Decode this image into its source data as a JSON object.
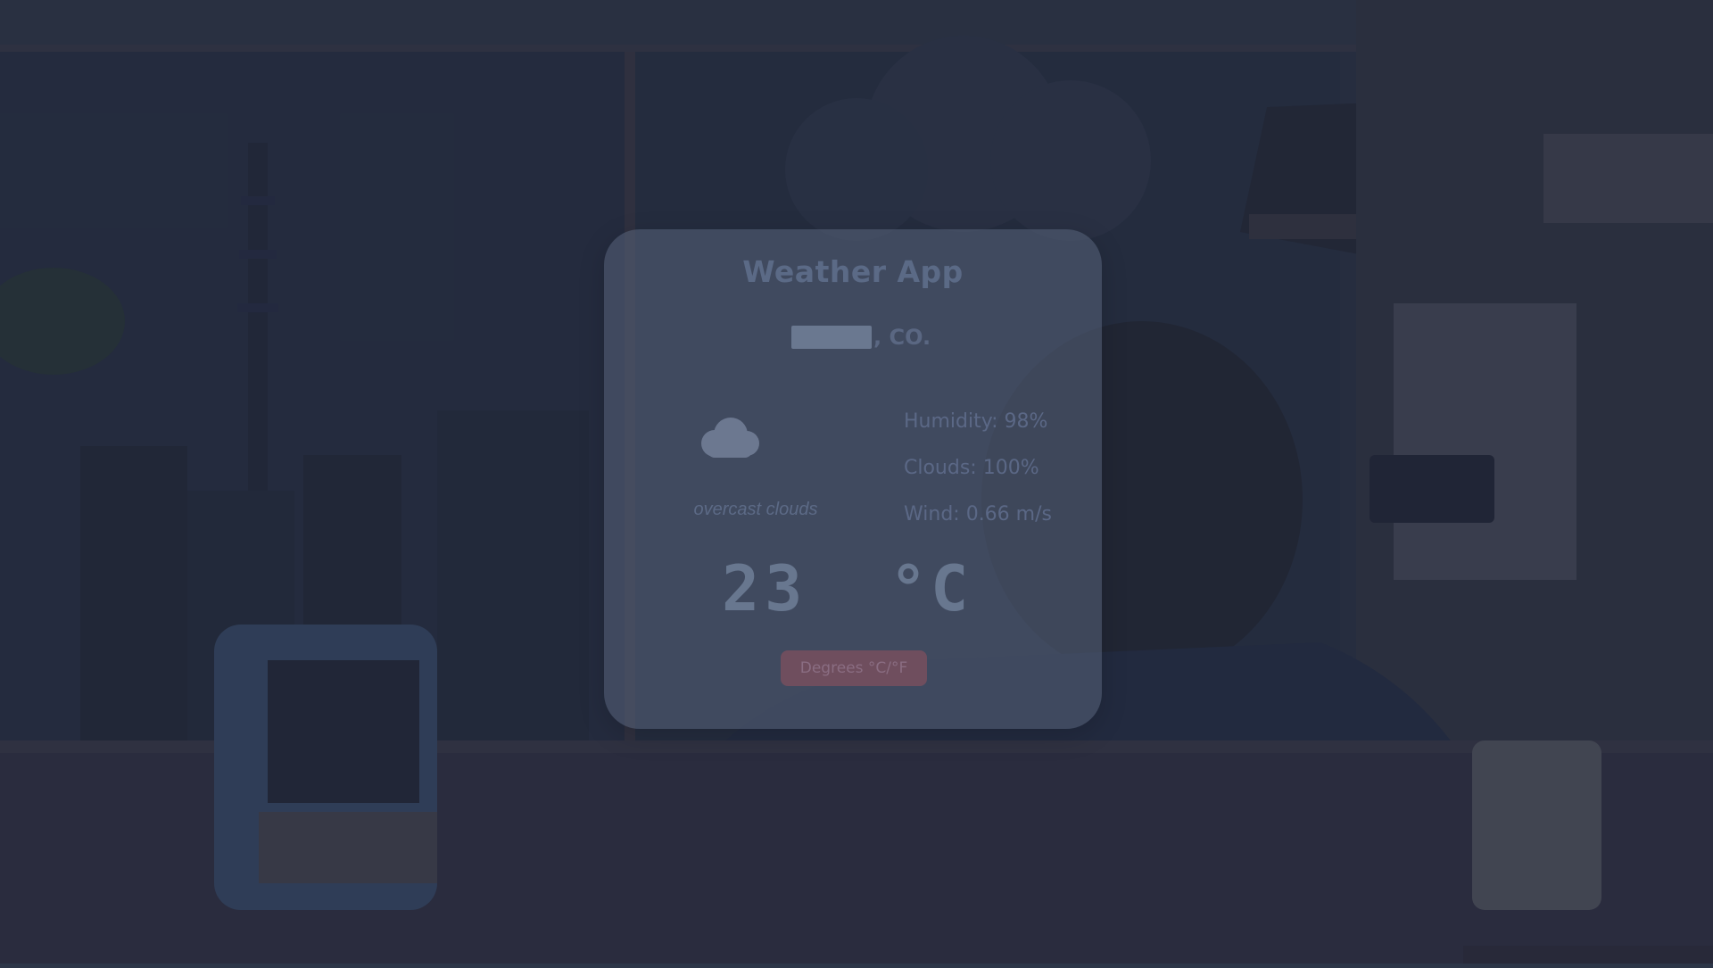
{
  "app": {
    "title": "Weather App"
  },
  "location": {
    "text": ", CO."
  },
  "weather": {
    "icon": "cloud-icon",
    "condition": "overcast clouds",
    "humidity": "Humidity: 98%",
    "clouds": "Clouds: 100%",
    "wind": "Wind: 0.66 m/s",
    "temperature": "23",
    "unit": "°C"
  },
  "controls": {
    "toggle_label": "Degrees °C/°F"
  },
  "colors": {
    "card": "#5c6880",
    "button": "#6f4e5e",
    "text": "#5b6886"
  }
}
